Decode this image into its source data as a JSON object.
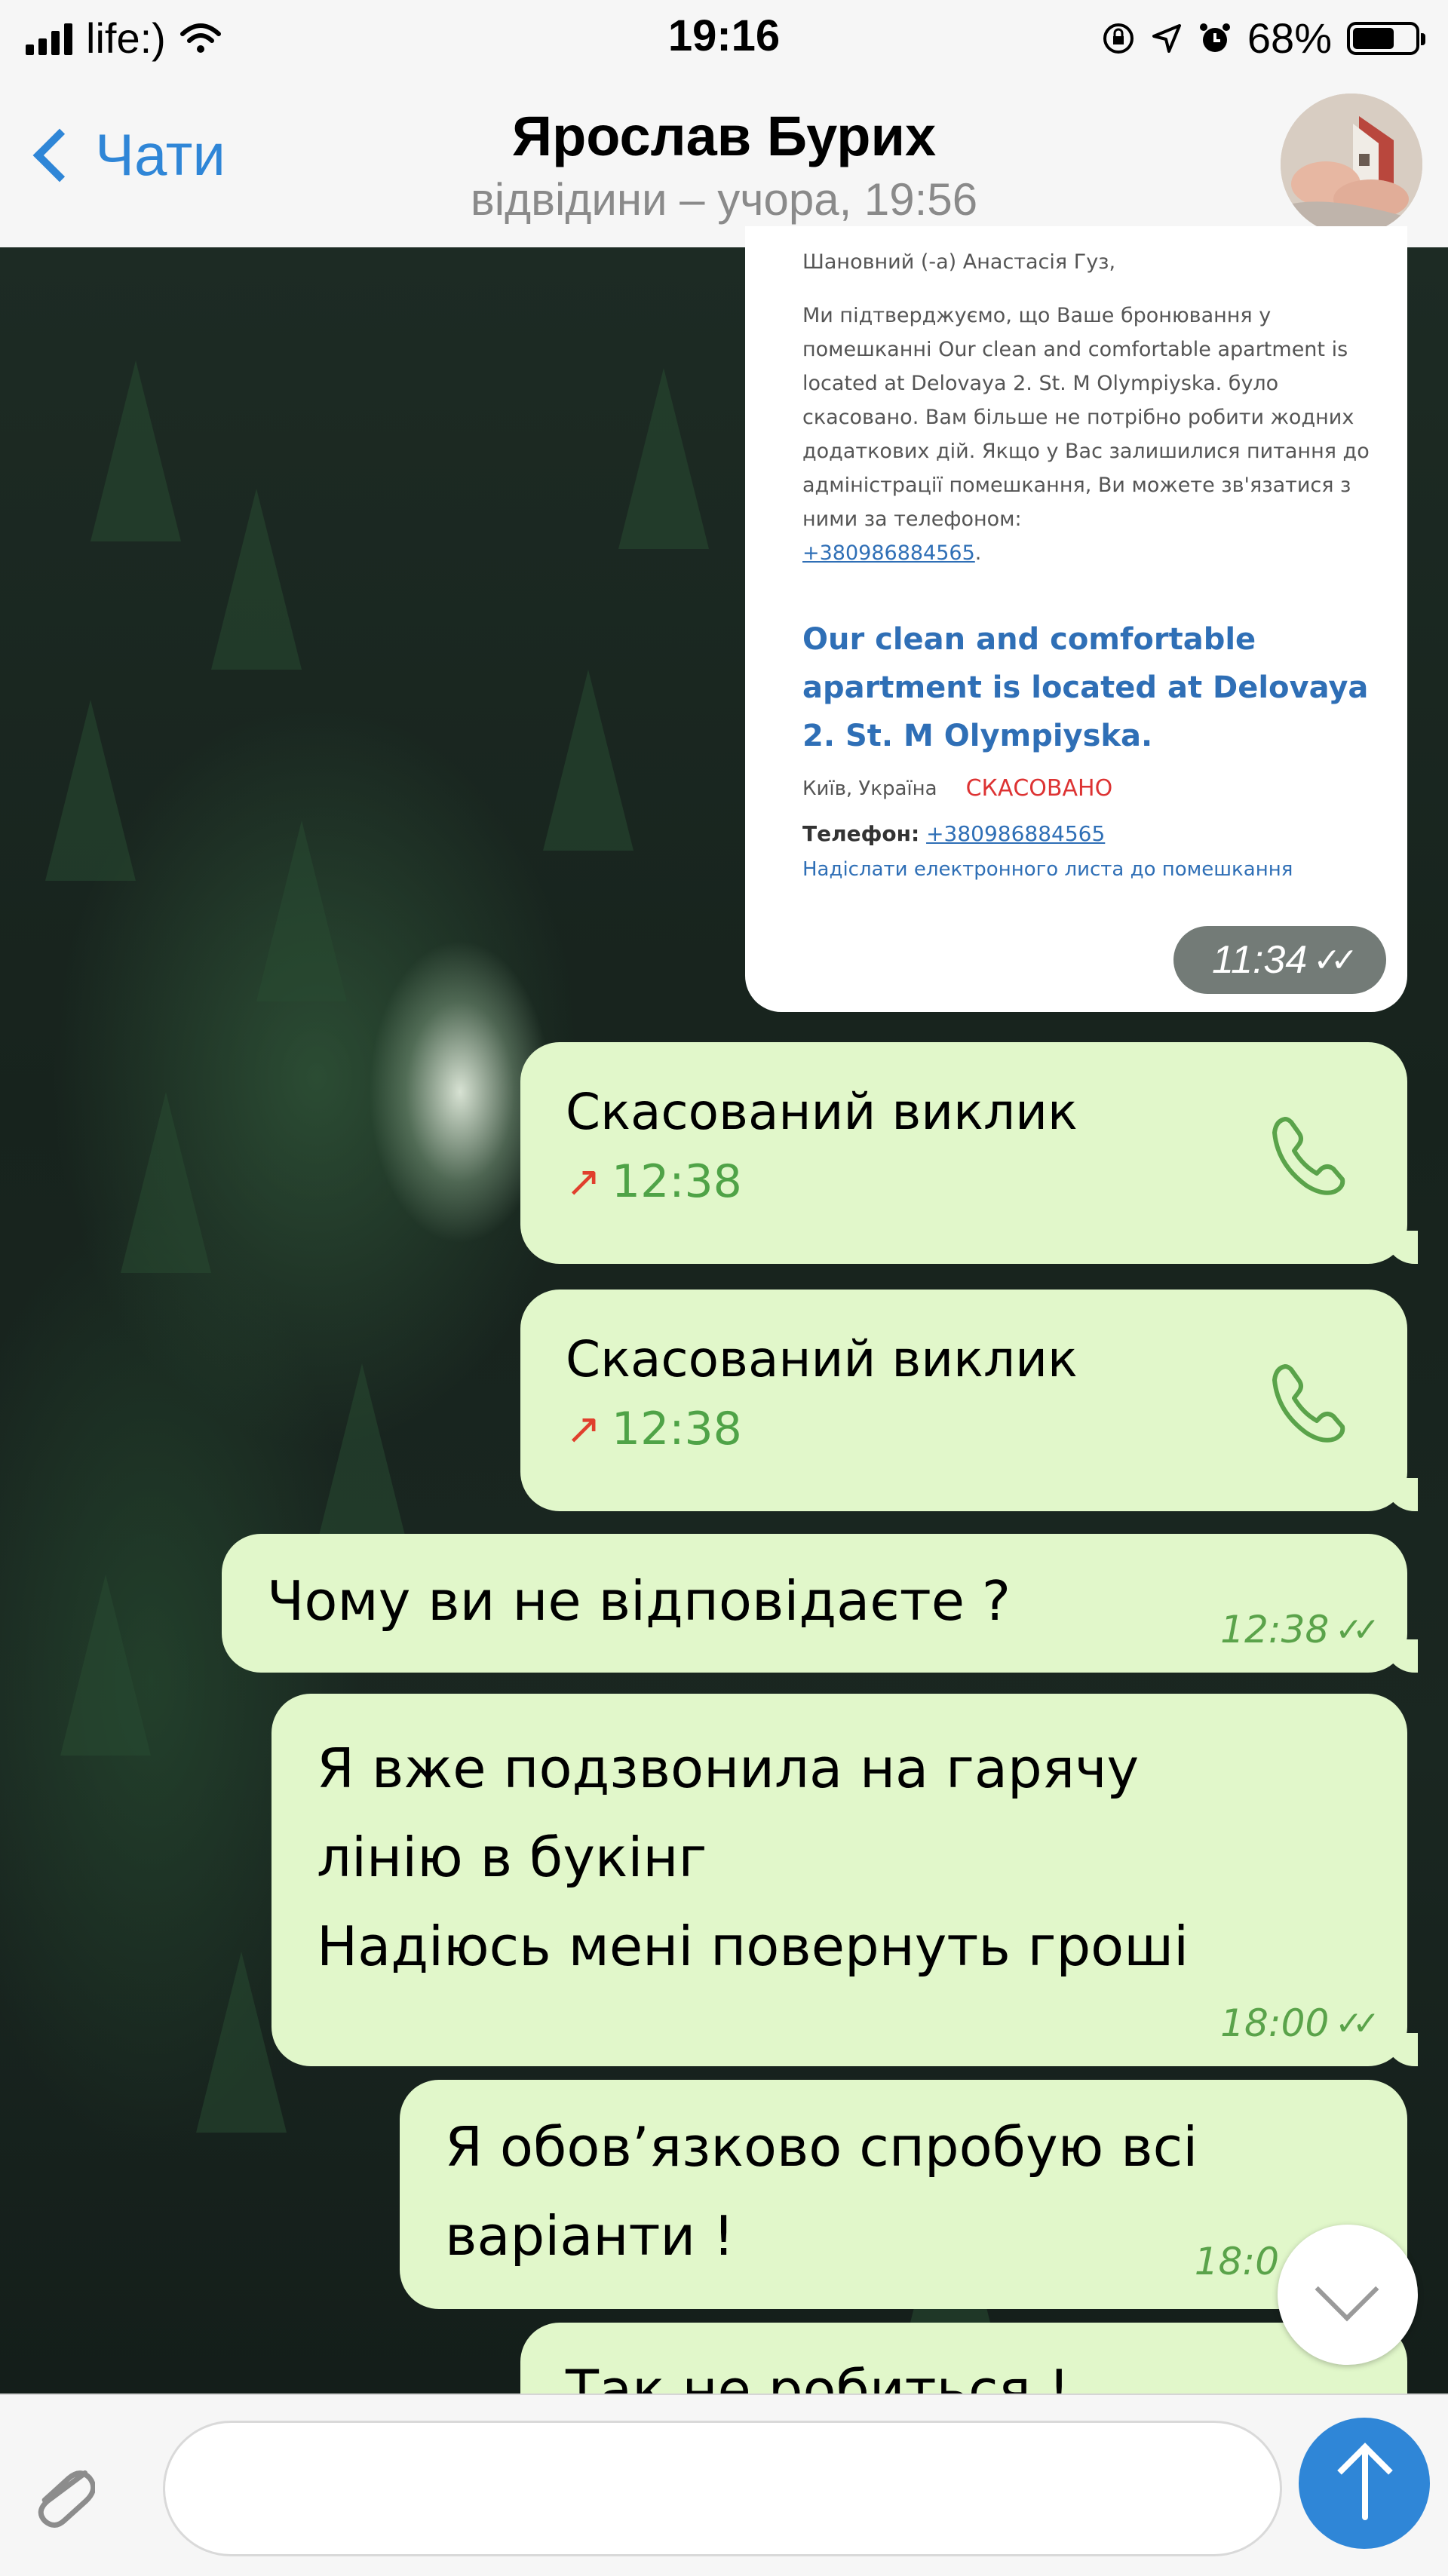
{
  "status_bar": {
    "carrier": "life:)",
    "time": "19:16",
    "battery": "68%",
    "battery_level": 0.68
  },
  "header": {
    "back_label": "Чати",
    "title": "Ярослав Бурих",
    "subtitle": "відвідини – учора, 19:56"
  },
  "email": {
    "greeting": "Шановний (-а) Анастасія Гуз,",
    "body": "Ми підтверджуємо, що Ваше бронювання у помешканні Our clean and comfortable apartment is located at Delovaya 2. St. M Olympiyska. було скасовано. Вам більше не потрібно робити жодних додаткових дій. Якщо у Вас залишилися питання до адміністрації помешкання, Ви можете зв'язатися з ними за телефоном:",
    "phone_link": "+380986884565",
    "hotel_name": "Our clean and comfortable apartment is located at Delovaya 2. St. M Olympiyska.",
    "location": "Київ, Україна",
    "status": "СКАСОВАНО",
    "phone_label": "Телефон:",
    "phone_value": "+380986884565",
    "email_link": "Надіслати електронного листа до помешкання",
    "time": "11:34"
  },
  "messages": [
    {
      "type": "call",
      "text": "Скасований виклик",
      "time": "12:38"
    },
    {
      "type": "call",
      "text": "Скасований виклик",
      "time": "12:38"
    },
    {
      "type": "text",
      "text": "Чому ви не відповідаєте ?",
      "time": "12:38"
    },
    {
      "type": "text",
      "line1": "Я вже подзвонила на гарячу",
      "line2": "лінію в букінг",
      "line3": "Надіюсь мені повернуть гроші",
      "time": "18:00"
    },
    {
      "type": "text",
      "line1": "Я обовʼязково спробую всі",
      "line2": "варіанти !",
      "time": "18:0"
    },
    {
      "type": "text",
      "text": "Так не робиться !"
    }
  ],
  "icons": {
    "back": "chevron-left-icon",
    "call": "phone-icon",
    "outgoing": "arrow-up-right-icon",
    "read": "double-check-icon",
    "scroll": "chevron-down-icon",
    "attach": "paperclip-icon",
    "send": "arrow-up-icon"
  },
  "colors": {
    "accent": "#2f86d7",
    "bubble": "#e1f7ca",
    "time_green": "#5aa34a",
    "cancel_red": "#d33333"
  },
  "input": {
    "placeholder": ""
  }
}
